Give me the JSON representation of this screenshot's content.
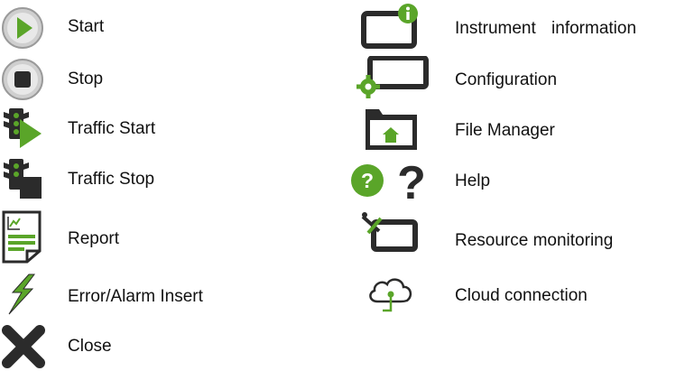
{
  "colors": {
    "green": "#5aa529",
    "dark": "#2b2b2b",
    "grey": "#bdbdbd"
  },
  "left": [
    {
      "label": "Start",
      "icon": "play-circle-icon"
    },
    {
      "label": "Stop",
      "icon": "stop-circle-icon"
    },
    {
      "label": "Traffic Start",
      "icon": "traffic-start-icon"
    },
    {
      "label": "Traffic Stop",
      "icon": "traffic-stop-icon"
    },
    {
      "label": "Report",
      "icon": "report-icon"
    },
    {
      "label": "Error/Alarm Insert",
      "icon": "lightning-icon"
    },
    {
      "label": "Close",
      "icon": "close-x-icon"
    }
  ],
  "right": [
    {
      "label": "Instrument information",
      "icon": "instrument-info-icon"
    },
    {
      "label": "Configuration",
      "icon": "configuration-icon"
    },
    {
      "label": "File Manager",
      "icon": "file-manager-icon"
    },
    {
      "label": "Help",
      "icon": "help-icon"
    },
    {
      "label": "Resource monitoring",
      "icon": "resource-monitoring-icon"
    },
    {
      "label": "Cloud connection",
      "icon": "cloud-connection-icon"
    }
  ]
}
